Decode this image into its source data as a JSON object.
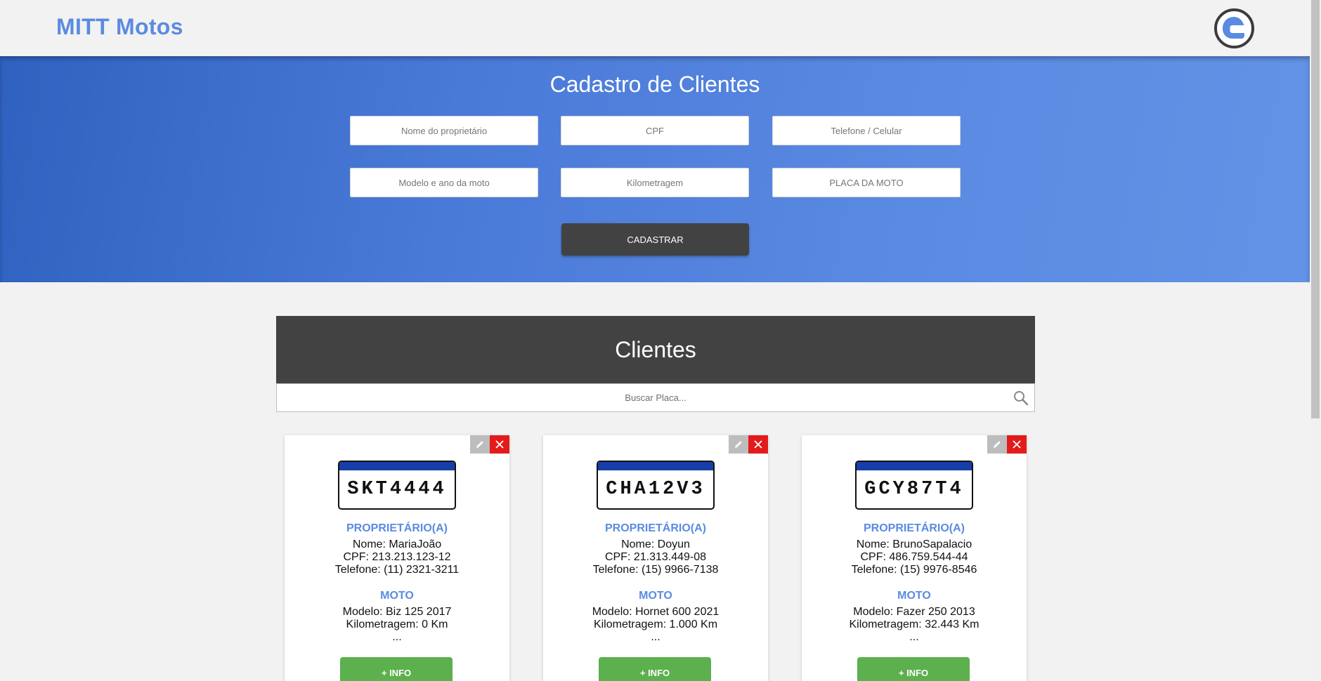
{
  "header": {
    "brand": "MITT Motos",
    "avatar_icon": "helmet-icon"
  },
  "form": {
    "title": "Cadastro de Clientes",
    "fields": {
      "owner": "Nome do proprietário",
      "cpf": "CPF",
      "phone": "Telefone / Celular",
      "model": "Modelo e ano da moto",
      "km": "Kilometragem",
      "plate": "PLACA DA MOTO"
    },
    "submit_label": "CADASTRAR"
  },
  "clients": {
    "title": "Clientes",
    "search_placeholder": "Buscar Placa...",
    "cards": [
      {
        "plate": "SKT4444",
        "owner_heading": "PROPRIETÁRIO(A)",
        "name": "Nome: MariaJoão",
        "cpf": "CPF: 213.213.123-12",
        "phone": "Telefone: (11) 2321-3211",
        "moto_heading": "MOTO",
        "model": "Modelo: Biz 125 2017",
        "km": "Kilometragem: 0 Km",
        "more": "...",
        "info_label": "+ INFO"
      },
      {
        "plate": "CHA12V3",
        "owner_heading": "PROPRIETÁRIO(A)",
        "name": "Nome: Doyun",
        "cpf": "CPF: 21.313.449-08",
        "phone": "Telefone: (15) 9966-7138",
        "moto_heading": "MOTO",
        "model": "Modelo: Hornet 600 2021",
        "km": "Kilometragem: 1.000 Km",
        "more": "...",
        "info_label": "+ INFO"
      },
      {
        "plate": "GCY87T4",
        "owner_heading": "PROPRIETÁRIO(A)",
        "name": "Nome: BrunoSapalacio",
        "cpf": "CPF: 486.759.544-44",
        "phone": "Telefone: (15) 9976-8546",
        "moto_heading": "MOTO",
        "model": "Modelo: Fazer 250 2013",
        "km": "Kilometragem: 32.443 Km",
        "more": "...",
        "info_label": "+ INFO"
      }
    ]
  },
  "colors": {
    "accent": "#5b8be0",
    "dark": "#424242",
    "success": "#5cb04d",
    "danger": "#e31b1b",
    "plate_band": "#163ea8"
  }
}
